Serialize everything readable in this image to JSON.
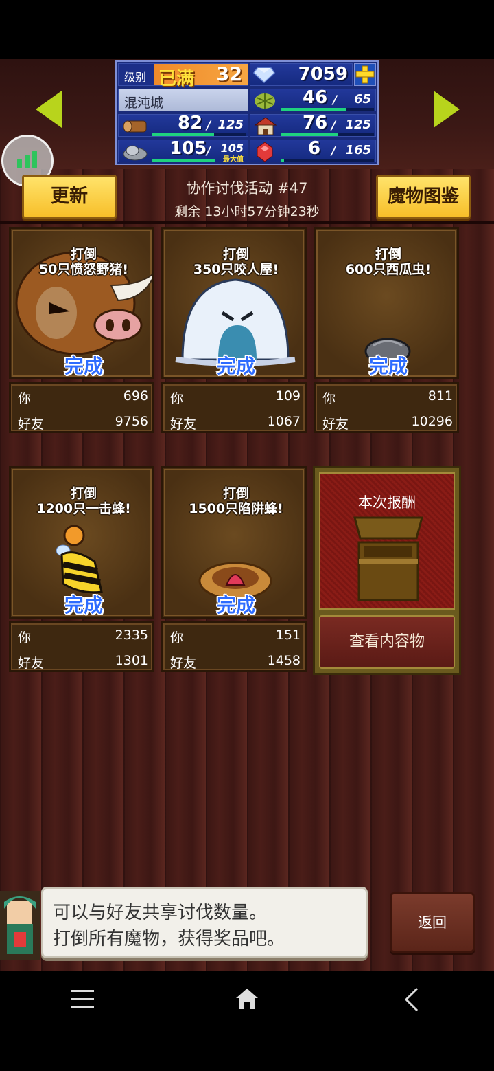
{
  "stats": {
    "level_label": "级别",
    "level_status": "已满",
    "level_value": "32",
    "gems": "7059",
    "town_name": "混沌城",
    "food": "46",
    "food_max": "65",
    "wood": "82",
    "wood_max": "125",
    "pop": "76",
    "pop_max": "125",
    "ore": "105",
    "ore_max": "105",
    "ore_max_label": "最大值",
    "ruby": "6",
    "ruby_max": "165",
    "slash": "/",
    "wood_fill": 0.656,
    "food_fill": 0.708,
    "pop_fill": 0.608,
    "ore_fill": 1.0,
    "ruby_fill": 0.036
  },
  "header": {
    "refresh": "更新",
    "event_title": "协作讨伐活动 #47",
    "remaining": "剩余 13小时57分钟23秒",
    "monster_book": "魔物图鉴"
  },
  "cards": [
    {
      "line1": "打倒",
      "line2": "50只愤怒野猪!",
      "done": "完成",
      "you_label": "你",
      "you": "696",
      "friend_label": "好友",
      "friend": "9756"
    },
    {
      "line1": "打倒",
      "line2": "350只咬人屋!",
      "done": "完成",
      "you_label": "你",
      "you": "109",
      "friend_label": "好友",
      "friend": "1067"
    },
    {
      "line1": "打倒",
      "line2": "600只西瓜虫!",
      "done": "完成",
      "you_label": "你",
      "you": "811",
      "friend_label": "好友",
      "friend": "10296"
    },
    {
      "line1": "打倒",
      "line2": "1200只一击蜂!",
      "done": "完成",
      "you_label": "你",
      "you": "2335",
      "friend_label": "好友",
      "friend": "1301"
    },
    {
      "line1": "打倒",
      "line2": "1500只陷阱蜂!",
      "done": "完成",
      "you_label": "你",
      "you": "151",
      "friend_label": "好友",
      "friend": "1458"
    }
  ],
  "reward": {
    "title": "本次报酬",
    "view": "查看内容物"
  },
  "dialog": {
    "line1": "可以与好友共享讨伐数量。",
    "line2": "打倒所有魔物，获得奖品吧。"
  },
  "back": "返回",
  "colors": {
    "accent": "#f7bf2a",
    "done_text": "#2d6cff",
    "bar_fill": "#1fd27e"
  }
}
